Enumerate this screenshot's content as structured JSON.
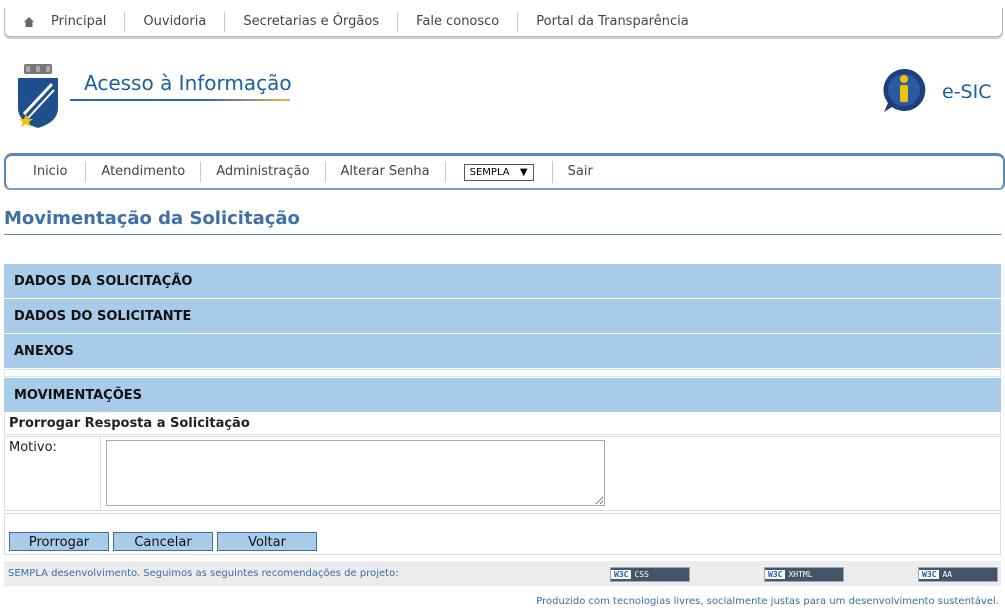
{
  "top_nav": {
    "items": [
      "Principal",
      "Ouvidoria",
      "Secretarias e Órgãos",
      "Fale conosco",
      "Portal da Transparência"
    ]
  },
  "header": {
    "site_title": "Acesso à Informação",
    "esic_label": "e-SIC"
  },
  "main_nav": {
    "items": [
      "Inicio",
      "Atendimento",
      "Administração",
      "Alterar Senha"
    ],
    "select_value": "SEMPLA",
    "logout": "Sair"
  },
  "page": {
    "title": "Movimentação da Solicitação"
  },
  "panels": [
    "DADOS DA SOLICITAÇÃO",
    "DADOS DO SOLICITANTE",
    "ANEXOS",
    "MOVIMENTAÇÕES"
  ],
  "form": {
    "heading": "Prorrogar Resposta a Solicitação",
    "motivo_label": "Motivo:",
    "motivo_value": ""
  },
  "buttons": {
    "prorrogar": "Prorrogar",
    "cancelar": "Cancelar",
    "voltar": "Voltar"
  },
  "footer": {
    "text": "SEMPLA desenvolvimento. Seguimos as seguintes recomendações de projeto:",
    "badges": [
      "CSS",
      "XHTML",
      "AA"
    ],
    "tagline": "Produzido com tecnologias livres, socialmente justas para um desenvolvimento sustentável."
  },
  "colors": {
    "panel_bg": "#a8cbea",
    "title_blue": "#3f6fa6",
    "nav_border": "#5b87b7"
  }
}
